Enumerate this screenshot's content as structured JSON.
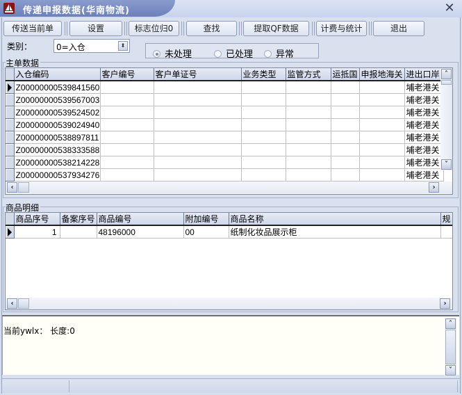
{
  "window": {
    "title": "传递申报数据(华南物流)",
    "close_glyph": "✕"
  },
  "toolbar": {
    "buttons": [
      {
        "label": "传送当前单"
      },
      {
        "label": "设置"
      },
      {
        "label": "标志位归0"
      },
      {
        "label": "查找"
      },
      {
        "label": "提取QF数据"
      },
      {
        "label": "计费与统计"
      },
      {
        "label": "退出"
      }
    ]
  },
  "filter": {
    "category_label": "类别：",
    "category_value": "0=入仓",
    "status_options": [
      {
        "label": "未处理",
        "selected": true
      },
      {
        "label": "已处理",
        "selected": false
      },
      {
        "label": "异常",
        "selected": false
      }
    ]
  },
  "main_grid": {
    "group_label": "主单数据",
    "columns": [
      "入仓编码",
      "客户编号",
      "客户单证号",
      "业务类型",
      "监管方式",
      "运抵国",
      "申报地海关",
      "进出口岸"
    ],
    "rows": [
      [
        "Z00000000539841560",
        "",
        "",
        "",
        "",
        "",
        "",
        "埔老港关"
      ],
      [
        "Z00000000539567003",
        "",
        "",
        "",
        "",
        "",
        "",
        "埔老港关"
      ],
      [
        "Z00000000539524502",
        "",
        "",
        "",
        "",
        "",
        "",
        "埔老港关"
      ],
      [
        "Z00000000539024940",
        "",
        "",
        "",
        "",
        "",
        "",
        "埔老港关"
      ],
      [
        "Z00000000538897811",
        "",
        "",
        "",
        "",
        "",
        "",
        "埔老港关"
      ],
      [
        "Z00000000538333588",
        "",
        "",
        "",
        "",
        "",
        "",
        "埔老港关"
      ],
      [
        "Z00000000538214228",
        "",
        "",
        "",
        "",
        "",
        "",
        "埔老港关"
      ],
      [
        "Z00000000537934276",
        "",
        "",
        "",
        "",
        "",
        "",
        "埔老港关"
      ]
    ],
    "current_row": 0
  },
  "detail_grid": {
    "group_label": "商品明细",
    "columns": [
      "商品序号",
      "备案序号",
      "商品编号",
      "附加编号",
      "商品名称",
      "规"
    ],
    "rows": [
      [
        "1",
        "",
        "48196000",
        "00",
        "纸制化妆品展示柜",
        ""
      ]
    ],
    "current_row": 0
  },
  "log": {
    "text": "当前ywlx： 长度:0"
  },
  "status_bar": {
    "panes": [
      "",
      ""
    ]
  },
  "icons": {
    "scroll_left": "‹",
    "scroll_right": "›",
    "scroll_up": "˄",
    "scroll_down": "˅",
    "combo_arrow": "⬍"
  }
}
